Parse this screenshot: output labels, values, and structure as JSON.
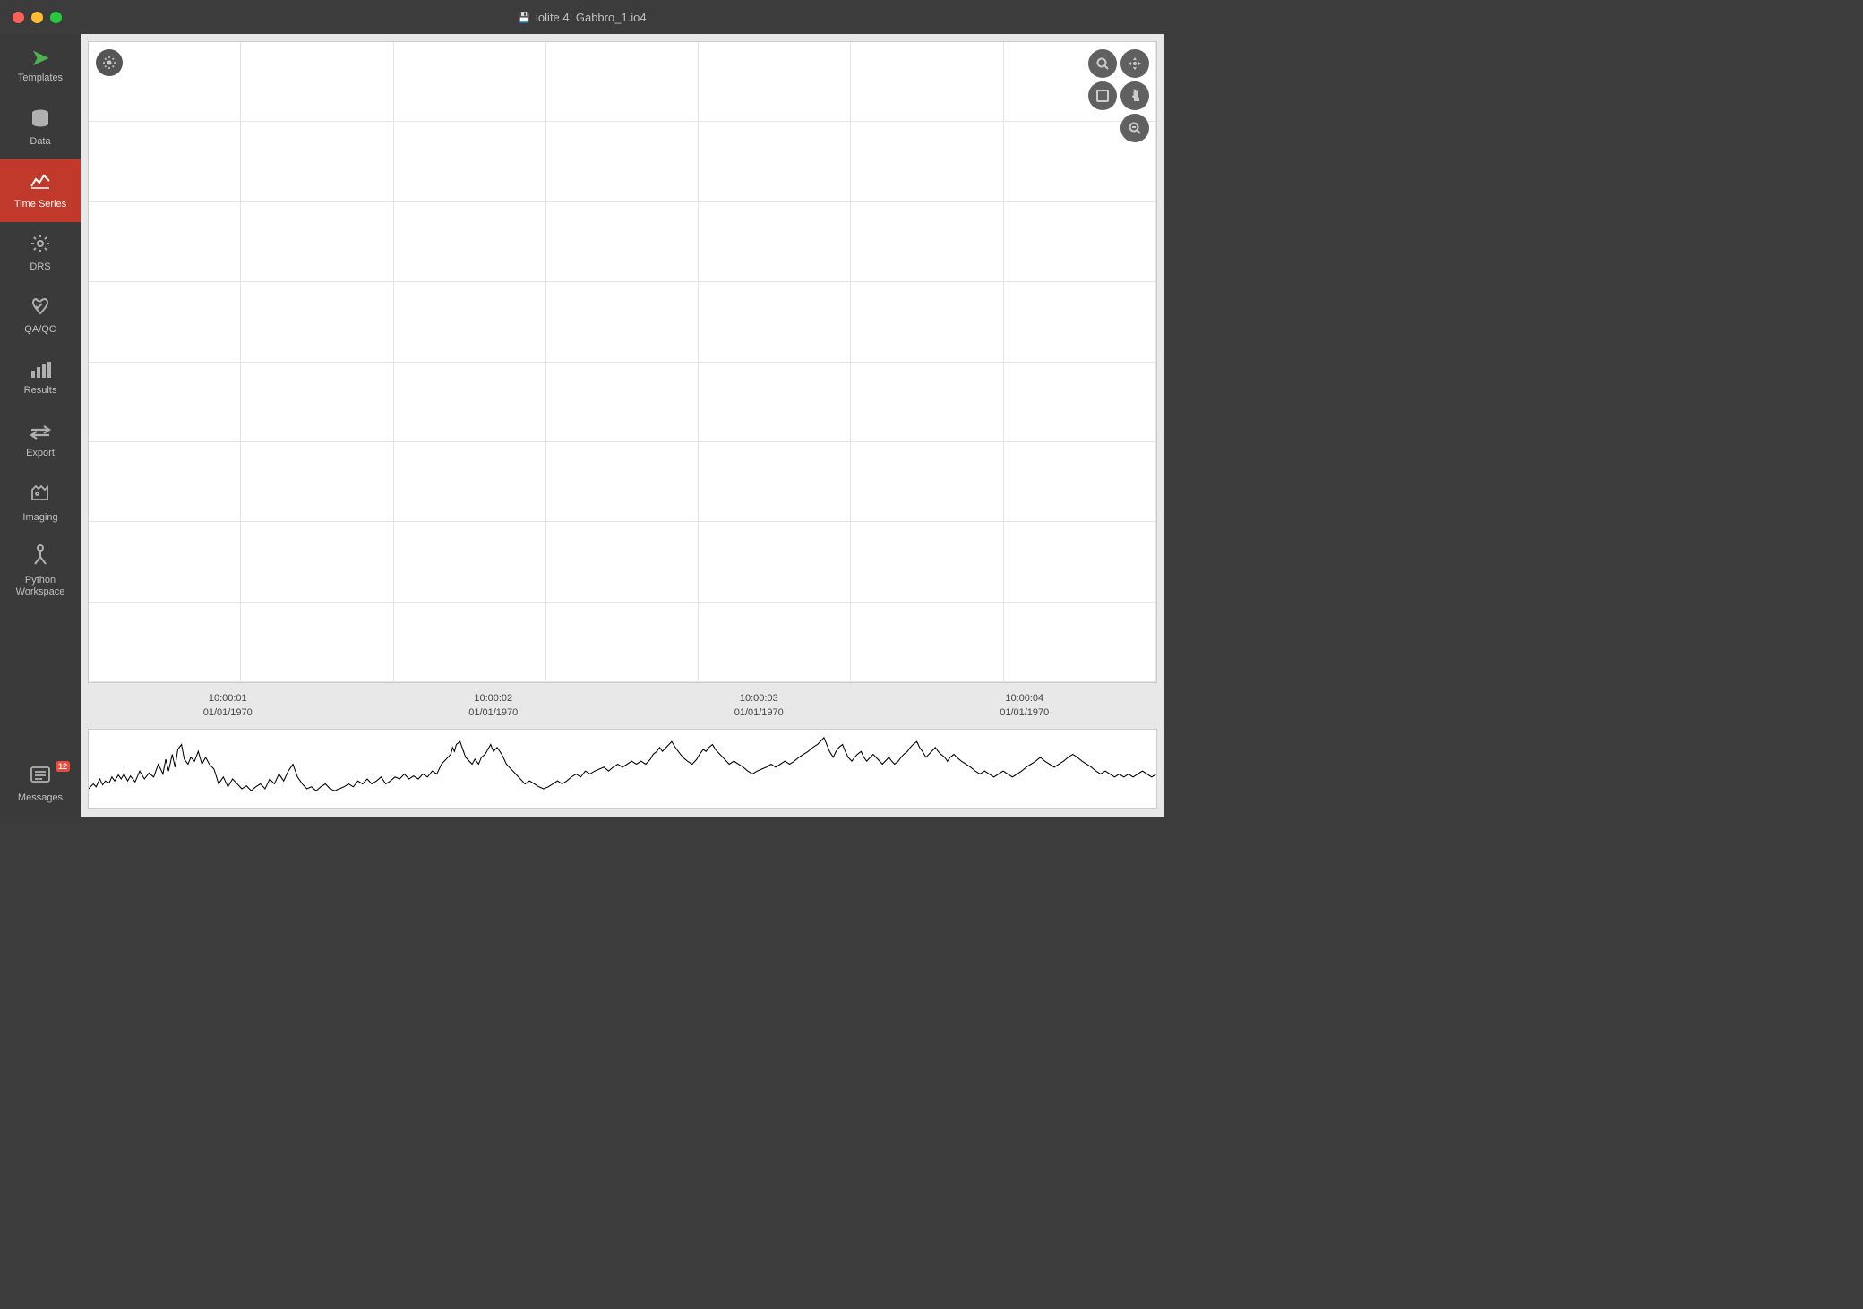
{
  "titlebar": {
    "title": "iolite 4: Gabbro_1.io4",
    "icon": "💾"
  },
  "sidebar": {
    "items": [
      {
        "id": "templates",
        "label": "Templates",
        "icon": "▷",
        "active": false,
        "isTemplates": true
      },
      {
        "id": "data",
        "label": "Data",
        "icon": "🗄",
        "active": false
      },
      {
        "id": "time-series",
        "label": "Time Series",
        "icon": "📈",
        "active": true
      },
      {
        "id": "drs",
        "label": "DRS",
        "icon": "⚙",
        "active": false
      },
      {
        "id": "qaqc",
        "label": "QA/QC",
        "icon": "👍",
        "active": false
      },
      {
        "id": "results",
        "label": "Results",
        "icon": "📊",
        "active": false
      },
      {
        "id": "export",
        "label": "Export",
        "icon": "⇄",
        "active": false
      },
      {
        "id": "imaging",
        "label": "Imaging",
        "icon": "🗺",
        "active": false
      },
      {
        "id": "python-workspace",
        "label": "Python Workspace",
        "icon": "⑂",
        "active": false
      },
      {
        "id": "messages",
        "label": "Messages",
        "icon": "📋",
        "active": false,
        "badge": "12"
      }
    ]
  },
  "chart": {
    "settings_btn_label": "⚙",
    "toolbar": {
      "btn1": "🔍",
      "btn2": "✋",
      "btn3": "⬛",
      "btn4": "✋",
      "btn5": "🔍"
    },
    "grid_cols": 7,
    "grid_rows": 8
  },
  "time_axis": {
    "labels": [
      {
        "time": "10:00:01",
        "date": "01/01/1970"
      },
      {
        "time": "10:00:02",
        "date": "01/01/1970"
      },
      {
        "time": "10:00:03",
        "date": "01/01/1970"
      },
      {
        "time": "10:00:04",
        "date": "01/01/1970"
      }
    ]
  },
  "colors": {
    "active_sidebar": "#c0392b",
    "sidebar_bg": "#3a3a3a",
    "titlebar_bg": "#3c3c3c",
    "content_bg": "#e8e8e8",
    "chart_bg": "#ffffff",
    "templates_green": "#4caf50"
  }
}
